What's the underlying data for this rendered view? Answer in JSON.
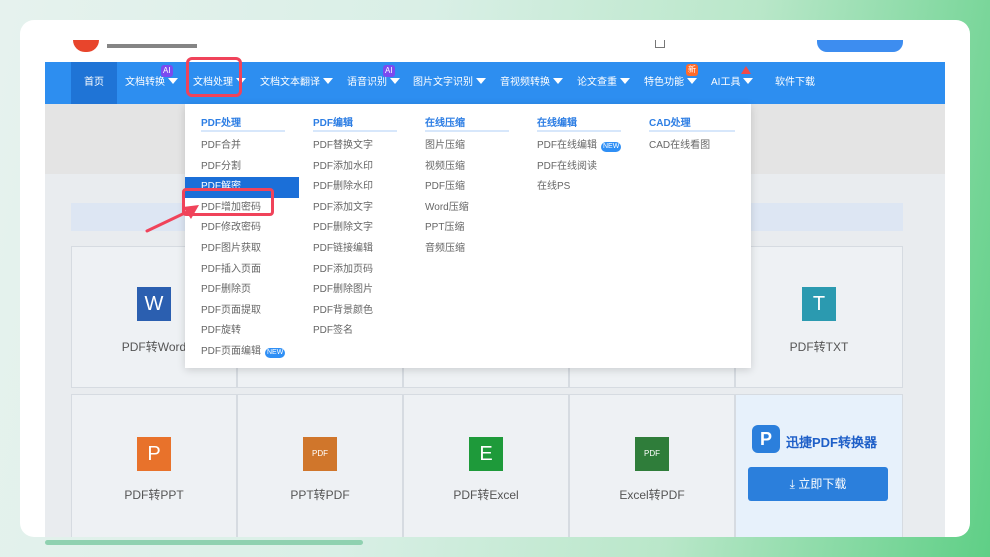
{
  "nav": {
    "items": [
      {
        "label": "首页",
        "caret": false
      },
      {
        "label": "文档转换",
        "caret": true,
        "badge": "AI"
      },
      {
        "label": "文档处理",
        "caret": true
      },
      {
        "label": "文档文本翻译",
        "caret": true
      },
      {
        "label": "语音识别",
        "caret": true,
        "badge": "AI"
      },
      {
        "label": "图片文字识别",
        "caret": true
      },
      {
        "label": "音视频转换",
        "caret": true
      },
      {
        "label": "论文查重",
        "caret": true
      },
      {
        "label": "特色功能",
        "caret": true,
        "badge": "新"
      },
      {
        "label": "AI工具",
        "caret": true
      },
      {
        "label": "软件下载",
        "caret": false
      }
    ]
  },
  "menu": {
    "columns": [
      {
        "title": "PDF处理",
        "items": [
          "PDF合并",
          "PDF分割",
          "PDF解密",
          "PDF增加密码",
          "PDF修改密码",
          "PDF图片获取",
          "PDF插入页面",
          "PDF删除页",
          "PDF页面提取",
          "PDF旋转",
          "PDF页面编辑"
        ]
      },
      {
        "title": "PDF编辑",
        "items": [
          "PDF替换文字",
          "PDF添加水印",
          "PDF删除水印",
          "PDF添加文字",
          "PDF删除文字",
          "PDF链接编辑",
          "PDF添加页码",
          "PDF删除图片",
          "PDF背景颜色",
          "PDF签名"
        ]
      },
      {
        "title": "在线压缩",
        "items": [
          "图片压缩",
          "视频压缩",
          "PDF压缩",
          "Word压缩",
          "PPT压缩",
          "音频压缩"
        ]
      },
      {
        "title": "在线编辑",
        "items": [
          "PDF在线编辑",
          "PDF在线阅读",
          "在线PS"
        ]
      },
      {
        "title": "CAD处理",
        "items": [
          "CAD在线看图"
        ]
      }
    ],
    "new_badge": "NEW"
  },
  "cards": {
    "pdf2word": {
      "label": "PDF转Word",
      "icon_text": "W"
    },
    "pdf2txt": {
      "label": "PDF转TXT",
      "icon_text": "T"
    },
    "pdf2ppt": {
      "label": "PDF转PPT",
      "icon_text": "P"
    },
    "ppt2pdf": {
      "label": "PPT转PDF",
      "icon_text": "PDF"
    },
    "pdf2excel": {
      "label": "PDF转Excel",
      "icon_text": "E"
    },
    "excel2pdf": {
      "label": "Excel转PDF",
      "icon_text": "PDF"
    }
  },
  "promo": {
    "title": "迅捷PDF转换器",
    "button": "立即下载",
    "logo_letter": "P"
  },
  "colors": {
    "nav_blue": "#2d8ef0",
    "highlight_red": "#f0435a",
    "active_blue": "#1b6fd8"
  }
}
